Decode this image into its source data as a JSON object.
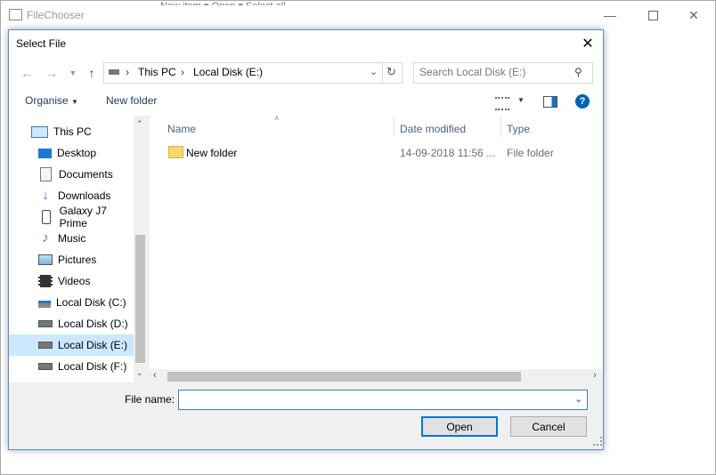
{
  "bg_window": {
    "title": "FileChooser",
    "strip_text": "New item ▾    Open ▾    Select all"
  },
  "dialog": {
    "title": "Select File",
    "address": {
      "crumbs": [
        "This PC",
        "Local Disk (E:)"
      ]
    },
    "search": {
      "placeholder": "Search Local Disk (E:)"
    },
    "toolbar": {
      "organise": "Organise",
      "new_folder": "New folder"
    },
    "nav_items": [
      {
        "label": "This PC",
        "icon": "computer-icon"
      },
      {
        "label": "Desktop",
        "icon": "desktop-icon"
      },
      {
        "label": "Documents",
        "icon": "documents-icon"
      },
      {
        "label": "Downloads",
        "icon": "downloads-icon"
      },
      {
        "label": "Galaxy J7 Prime",
        "icon": "phone-icon"
      },
      {
        "label": "Music",
        "icon": "music-icon"
      },
      {
        "label": "Pictures",
        "icon": "pictures-icon"
      },
      {
        "label": "Videos",
        "icon": "videos-icon"
      },
      {
        "label": "Local Disk (C:)",
        "icon": "windows-drive-icon"
      },
      {
        "label": "Local Disk (D:)",
        "icon": "drive-icon"
      },
      {
        "label": "Local Disk (E:)",
        "icon": "drive-icon",
        "selected": true
      },
      {
        "label": "Local Disk (F:)",
        "icon": "drive-icon"
      }
    ],
    "columns": {
      "name": "Name",
      "date": "Date modified",
      "type": "Type"
    },
    "files": [
      {
        "name": "New folder",
        "date": "14-09-2018 11:56 ...",
        "type": "File folder"
      }
    ],
    "file_name_label": "File name:",
    "file_name_value": "",
    "open_label": "Open",
    "cancel_label": "Cancel"
  },
  "colors": {
    "accent": "#0078d7",
    "selected": "#cce8ff",
    "folder": "#f5d66f"
  }
}
